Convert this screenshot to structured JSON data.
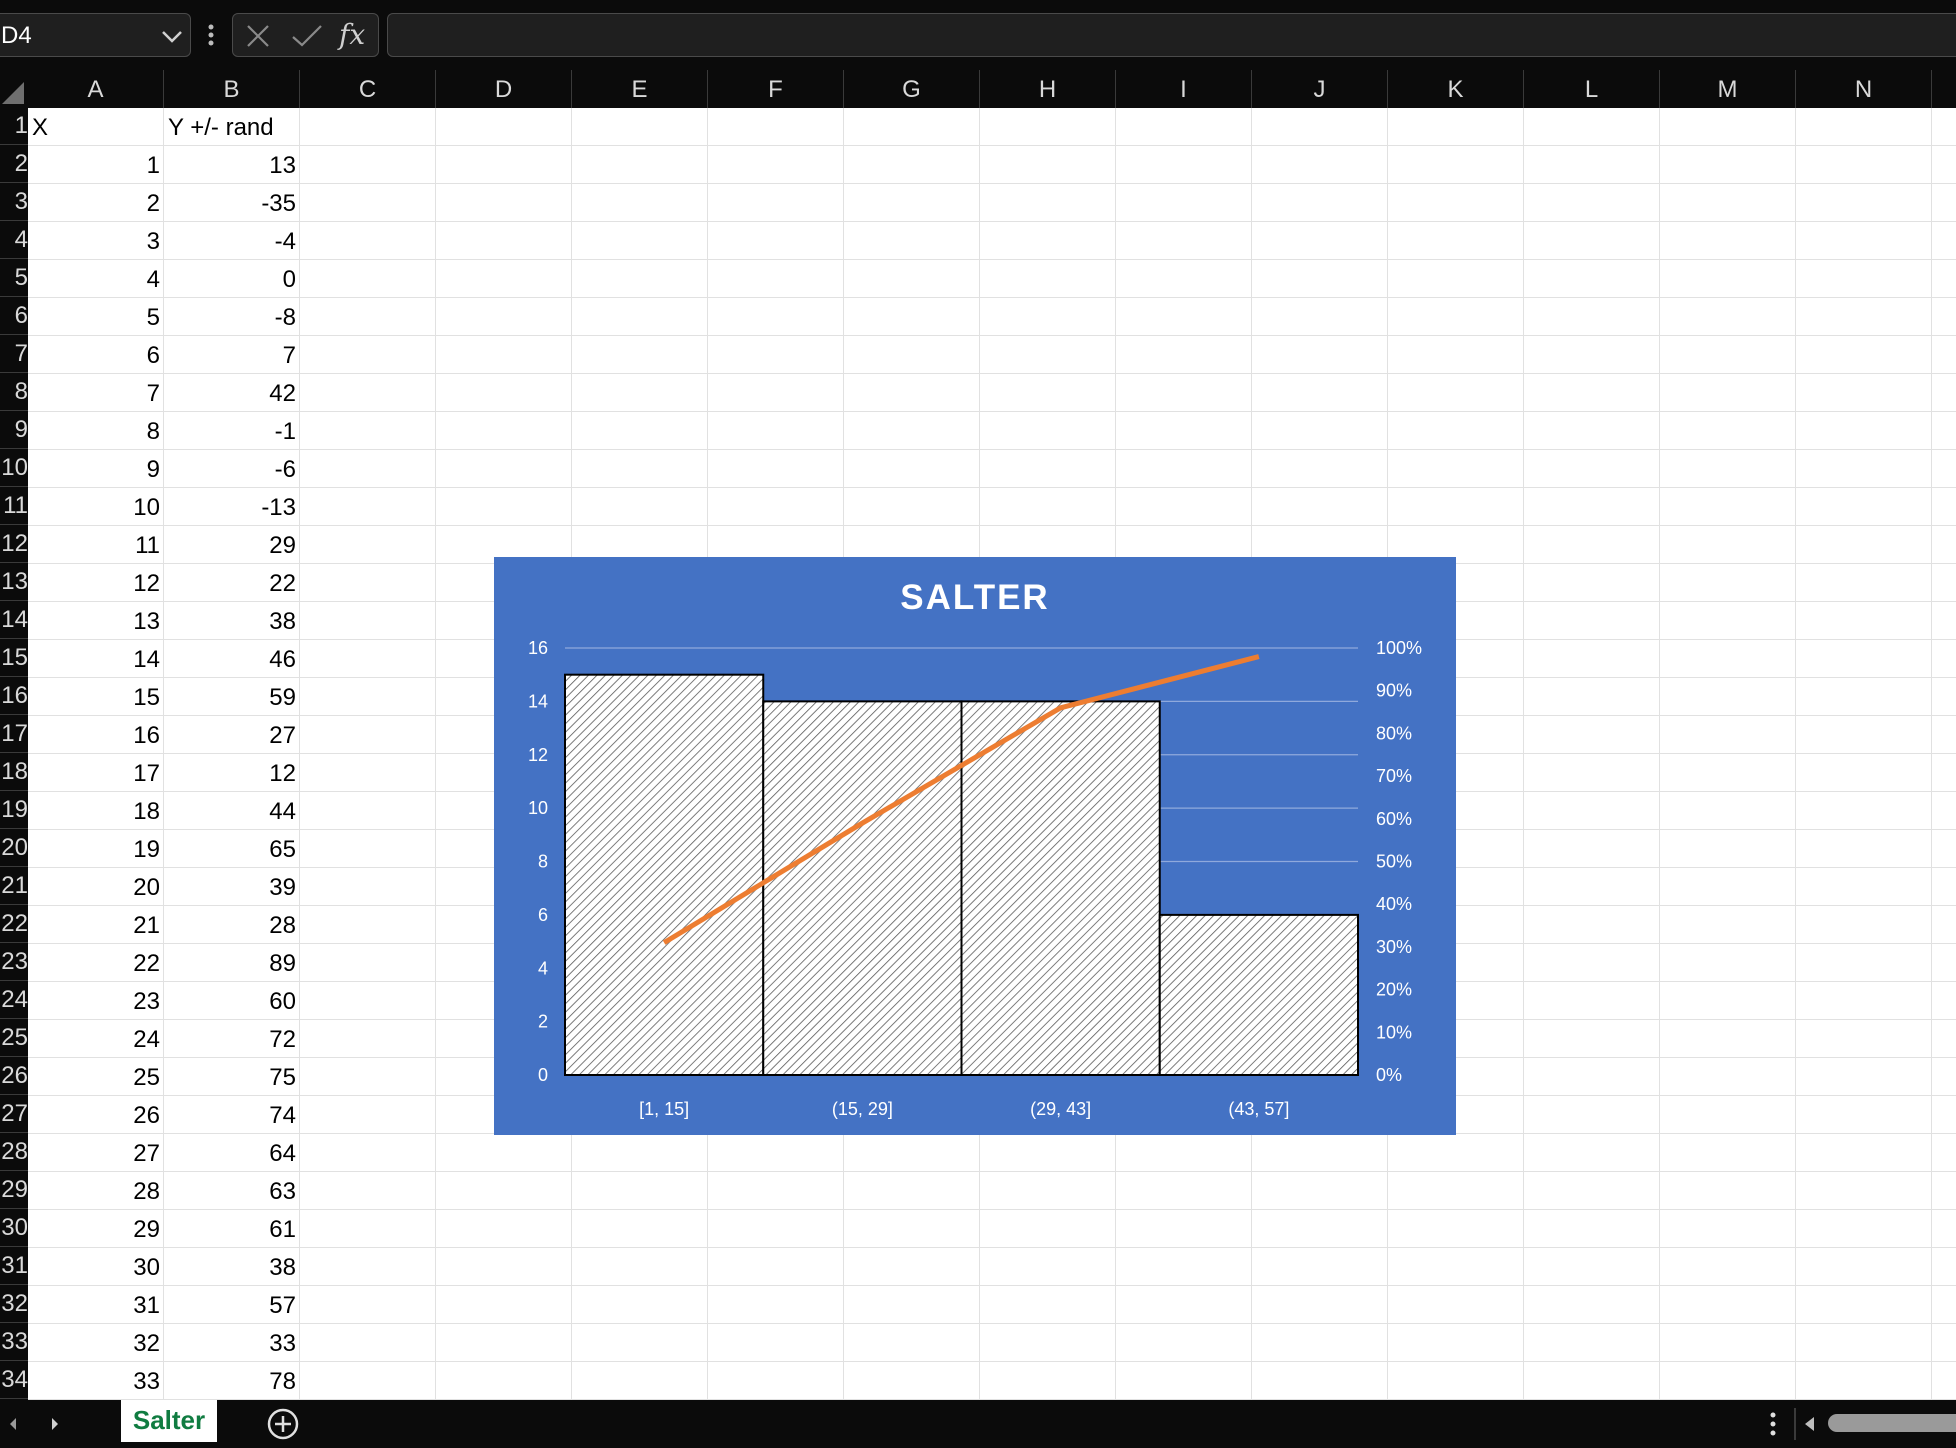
{
  "name_box": {
    "value": "D4"
  },
  "formula_bar": {
    "fx_label": "fx",
    "content": ""
  },
  "columns": [
    "A",
    "B",
    "C",
    "D",
    "E",
    "F",
    "G",
    "H",
    "I",
    "J",
    "K",
    "L",
    "M",
    "N"
  ],
  "rows": [
    "1",
    "2",
    "3",
    "4",
    "5",
    "6",
    "7",
    "8",
    "9",
    "10",
    "11",
    "12",
    "13",
    "14",
    "15",
    "16",
    "17",
    "18",
    "19",
    "20",
    "21",
    "22",
    "23",
    "24",
    "25",
    "26",
    "27",
    "28",
    "29",
    "30",
    "31",
    "32",
    "33",
    "34"
  ],
  "cells": {
    "A1": "X",
    "B1": "Y +/- rand",
    "A": [
      "1",
      "2",
      "3",
      "4",
      "5",
      "6",
      "7",
      "8",
      "9",
      "10",
      "11",
      "12",
      "13",
      "14",
      "15",
      "16",
      "17",
      "18",
      "19",
      "20",
      "21",
      "22",
      "23",
      "24",
      "25",
      "26",
      "27",
      "28",
      "29",
      "30",
      "31",
      "32",
      "33"
    ],
    "B": [
      "13",
      "-35",
      "-4",
      "0",
      "-8",
      "7",
      "42",
      "-1",
      "-6",
      "-13",
      "29",
      "22",
      "38",
      "46",
      "59",
      "27",
      "12",
      "44",
      "65",
      "39",
      "28",
      "89",
      "60",
      "72",
      "75",
      "74",
      "64",
      "63",
      "61",
      "38",
      "57",
      "33",
      "78"
    ]
  },
  "chart_data": {
    "type": "bar",
    "title": "SALTER",
    "categories": [
      "[1, 15]",
      "(15, 29]",
      "(29, 43]",
      "(43, 57]"
    ],
    "series": [
      {
        "type": "bar",
        "values": [
          15,
          14,
          14,
          6
        ]
      },
      {
        "type": "line",
        "axis": "secondary",
        "values": [
          0.31,
          0.59,
          0.86,
          0.98
        ]
      }
    ],
    "y_ticks": [
      "0",
      "2",
      "4",
      "6",
      "8",
      "10",
      "12",
      "14",
      "16"
    ],
    "ylim": [
      0,
      16
    ],
    "y2_ticks": [
      "0%",
      "10%",
      "20%",
      "30%",
      "40%",
      "50%",
      "60%",
      "70%",
      "80%",
      "90%",
      "100%"
    ],
    "y2lim": [
      0,
      1
    ],
    "grid": true,
    "legend": "none",
    "colors": {
      "background": "#4472c4",
      "bar_stroke": "#000000",
      "line": "#ed7d31",
      "gridline": "#8fa9dc",
      "text": "#ffffff"
    }
  },
  "sheet_tabs": {
    "active": "Salter"
  }
}
